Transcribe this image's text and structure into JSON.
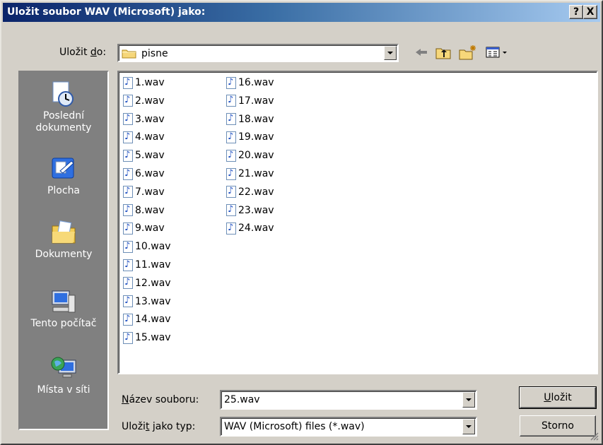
{
  "window": {
    "title": "Uložit soubor WAV (Microsoft) jako:",
    "help_label": "?",
    "close_label": "X"
  },
  "save_in": {
    "label_pre": "Uložit ",
    "label_key": "d",
    "label_post": "o:",
    "folder": "pisne"
  },
  "places": [
    {
      "label": "Poslední dokumenty",
      "icon": "recent-documents-icon"
    },
    {
      "label": "Plocha",
      "icon": "desktop-icon"
    },
    {
      "label": "Dokumenty",
      "icon": "my-documents-icon"
    },
    {
      "label": "Tento počítač",
      "icon": "my-computer-icon"
    },
    {
      "label": "Místa v síti",
      "icon": "network-places-icon"
    }
  ],
  "files": [
    "1.wav",
    "2.wav",
    "3.wav",
    "4.wav",
    "5.wav",
    "6.wav",
    "7.wav",
    "8.wav",
    "9.wav",
    "10.wav",
    "11.wav",
    "12.wav",
    "13.wav",
    "14.wav",
    "15.wav",
    "16.wav",
    "17.wav",
    "18.wav",
    "19.wav",
    "20.wav",
    "21.wav",
    "22.wav",
    "23.wav",
    "24.wav"
  ],
  "filename": {
    "label_key": "N",
    "label_rest": "ázev souboru:",
    "value": "25.wav"
  },
  "filetype": {
    "label_pre": "Uloži",
    "label_key": "t",
    "label_post": " jako typ:",
    "value": "WAV (Microsoft) files (*.wav)"
  },
  "buttons": {
    "save_key": "U",
    "save_rest": "ložit",
    "cancel": "Storno"
  }
}
